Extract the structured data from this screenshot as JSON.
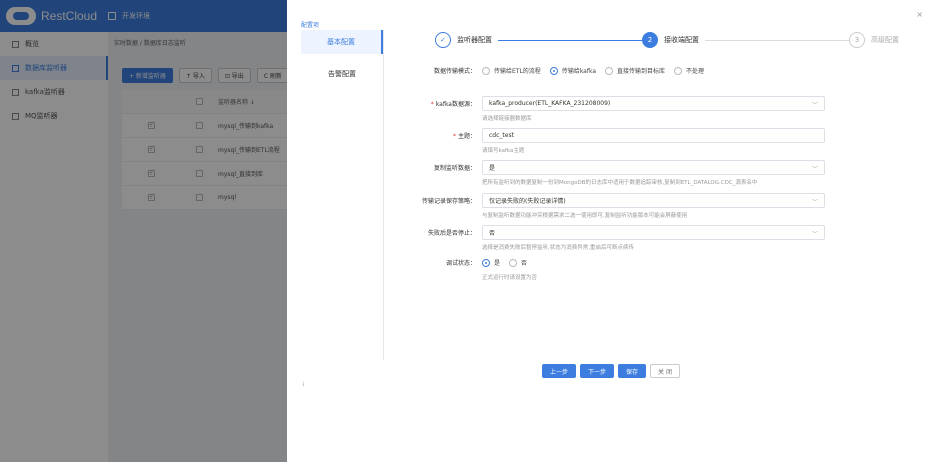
{
  "brand": {
    "name": "RestCloud"
  },
  "topbar": {
    "env_label": "开发环境"
  },
  "sidebar": {
    "items": [
      {
        "label": "概览",
        "icon": "chart-icon"
      },
      {
        "label": "数据库监听器",
        "icon": "database-icon",
        "active": true
      },
      {
        "label": "kafka监听器",
        "icon": "headset-icon"
      },
      {
        "label": "MQ监听器",
        "icon": "headset-icon"
      }
    ]
  },
  "breadcrumb": "实时数据 / 数据库日志监听",
  "toolbar": {
    "add_label": "+ 新增监听器",
    "import_label": "↑ 导入",
    "export_label": "⊡ 导出",
    "refresh_label": "C 刷新"
  },
  "table": {
    "header_name": "监听器名称 ↓",
    "rows": [
      "mysql_传输到kafka",
      "mysql_传输到ETL流程",
      "mysql_直接到库",
      "mysql"
    ]
  },
  "drawer": {
    "title": "配置项",
    "close": "×",
    "tabs": [
      "基本配置",
      "告警配置"
    ],
    "dot": "¡"
  },
  "steps": {
    "items": [
      {
        "num": "✓",
        "label": "监听器配置"
      },
      {
        "num": "2",
        "label": "接收端配置"
      },
      {
        "num": "3",
        "label": "高级配置"
      }
    ]
  },
  "form": {
    "mode_label": "数据传输模式：",
    "mode_options": [
      "传输给ETL的流程",
      "传输给kafka",
      "直接传输到目标库",
      "不处理"
    ],
    "mode_selected": 1,
    "kafka_label": "kafka数据源：",
    "kafka_value": "kafka_producer(ETL_KAFKA_231208009)",
    "kafka_help": "请选择链接器数据库",
    "topic_label": "主题：",
    "topic_value": "cdc_test",
    "topic_help": "请填写kafka主题",
    "copy_label": "复制监听数据：",
    "copy_value": "是",
    "copy_help": "把所有监听到的数据复制一份到MongoDB的日志库中适用于数据追踪审核,复制到ETL_DATALOG.CDC_源表名中",
    "policy_label": "传输记录保存策略：",
    "policy_value": "仅记录失败的(失败记录详情)",
    "policy_help": "与复制监听数据功能冲突根据需求二选一使用即可,复制监听功能版本可能会屏蔽使用",
    "stop_label": "失败后是否停止：",
    "stop_value": "否",
    "stop_help": "选择是消费失败后暂停监听,状态为消费异常,重启后可断点续传",
    "debug_label": "调试状态：",
    "debug_options": [
      "是",
      "否"
    ],
    "debug_selected": 0,
    "debug_help": "正式运行时请设置为否"
  },
  "buttons": {
    "prev": "上一步",
    "next": "下一步",
    "save": "保存",
    "close": "关 闭"
  }
}
